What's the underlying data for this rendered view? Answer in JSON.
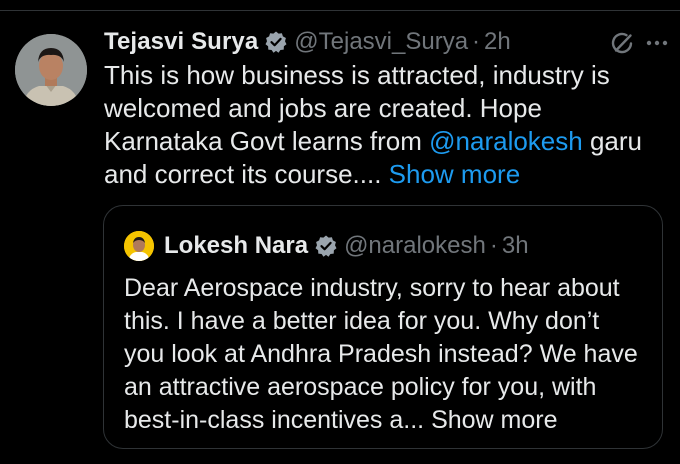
{
  "tweet": {
    "author_name": "Tejasvi Surya",
    "handle": "@Tejasvi_Surya",
    "separator": "·",
    "time": "2h",
    "text": "This is how business is attracted, industry is welcomed and jobs are created. Hope Karnataka Govt learns from ",
    "mention": "@naralokesh",
    "text_after_mention": " garu and correct its course.... ",
    "show_more_label": "Show more"
  },
  "quote": {
    "author_name": "Lokesh Nara",
    "handle": "@naralokesh",
    "separator": "·",
    "time": "3h",
    "text": "Dear Aerospace industry, sorry to hear about this. I have a better idea for you. Why don’t you look at Andhra Pradesh instead? We have an attractive aerospace policy for you, with best-in-class incentives a... ",
    "show_more_label": "Show more"
  },
  "icons": {
    "verified": "verified-badge-icon",
    "grok": "grok-icon",
    "more": "more-options-icon"
  },
  "colors": {
    "background": "#000000",
    "text": "#e7e9ea",
    "muted": "#71767b",
    "accent": "#1d9bf0",
    "border": "#2f3336"
  }
}
